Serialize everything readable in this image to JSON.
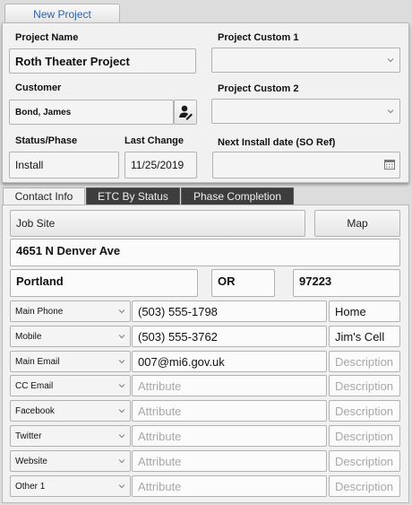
{
  "toolbar": {
    "new_project_label": "New Project"
  },
  "header_form": {
    "project_name_label": "Project Name",
    "project_name_value": "Roth Theater Project",
    "custom1_label": "Project Custom 1",
    "custom1_value": "",
    "customer_label": "Customer",
    "customer_value": "Bond, James",
    "custom2_label": "Project Custom 2",
    "custom2_value": "",
    "status_label": "Status/Phase",
    "status_value": "Install",
    "last_change_label": "Last Change",
    "last_change_value": "11/25/2019",
    "next_install_label": "Next Install date (SO Ref)",
    "next_install_value": ""
  },
  "tabs": [
    {
      "label": "Contact Info",
      "active": true
    },
    {
      "label": "ETC By Status",
      "active": false
    },
    {
      "label": "Phase Completion",
      "active": false
    }
  ],
  "contact": {
    "job_site_label": "Job Site",
    "map_label": "Map",
    "address": "4651 N Denver Ave",
    "city": "Portland",
    "state": "OR",
    "zip": "97223",
    "rows": [
      {
        "type": "Main Phone",
        "value": "(503) 555-1798",
        "value_placeholder": "",
        "desc": "Home",
        "desc_placeholder": ""
      },
      {
        "type": "Mobile",
        "value": "(503) 555-3762",
        "value_placeholder": "",
        "desc": "Jim's Cell",
        "desc_placeholder": ""
      },
      {
        "type": "Main Email",
        "value": "007@mi6.gov.uk",
        "value_placeholder": "",
        "desc": "",
        "desc_placeholder": "Description"
      },
      {
        "type": "CC Email",
        "value": "",
        "value_placeholder": "Attribute",
        "desc": "",
        "desc_placeholder": "Description"
      },
      {
        "type": "Facebook",
        "value": "",
        "value_placeholder": "Attribute",
        "desc": "",
        "desc_placeholder": "Description"
      },
      {
        "type": "Twitter",
        "value": "",
        "value_placeholder": "Attribute",
        "desc": "",
        "desc_placeholder": "Description"
      },
      {
        "type": "Website",
        "value": "",
        "value_placeholder": "Attribute",
        "desc": "",
        "desc_placeholder": "Description"
      },
      {
        "type": "Other 1",
        "value": "",
        "value_placeholder": "Attribute",
        "desc": "",
        "desc_placeholder": "Description"
      }
    ]
  },
  "icons": {
    "customer_lookup": "person-edit-icon",
    "calendar": "calendar-icon",
    "dropdown": "chevron-down-icon"
  },
  "colors": {
    "link_blue": "#2f5fa8",
    "tab_dark": "#3d3d3d",
    "placeholder_gray": "#a8a8a8"
  }
}
